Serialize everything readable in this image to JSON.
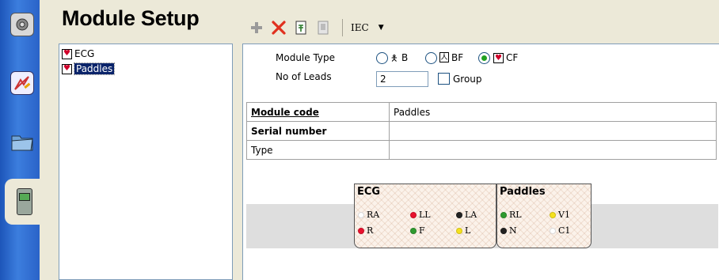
{
  "header": {
    "title": "Module Setup"
  },
  "toolbar": {
    "add_icon": "plus-icon",
    "delete_icon": "red-x-icon",
    "iec_label": "IEC"
  },
  "tree": {
    "items": [
      {
        "label": "ECG",
        "selected": false
      },
      {
        "label": "Paddles",
        "selected": true
      }
    ]
  },
  "form": {
    "module_type_label": "Module Type",
    "options": [
      {
        "label": "B",
        "checked": false
      },
      {
        "label": "BF",
        "checked": false
      },
      {
        "label": "CF",
        "checked": true
      }
    ],
    "leads_label": "No of Leads",
    "leads_value": "2",
    "group_label": "Group",
    "group_checked": false
  },
  "properties": [
    {
      "key": "Module code",
      "value": "Paddles"
    },
    {
      "key": "Serial number",
      "value": ""
    },
    {
      "key": "Type",
      "value": ""
    }
  ],
  "electrodes": {
    "ecg": {
      "title": "ECG",
      "items": [
        {
          "label": "RA",
          "color": "#ffffff"
        },
        {
          "label": "LL",
          "color": "#e8112d"
        },
        {
          "label": "LA",
          "color": "#222222"
        },
        {
          "label": "R",
          "color": "#e8112d"
        },
        {
          "label": "F",
          "color": "#2f9a2f"
        },
        {
          "label": "L",
          "color": "#f5e11e"
        }
      ]
    },
    "paddles": {
      "title": "Paddles",
      "items": [
        {
          "label": "RL",
          "color": "#2f9a2f"
        },
        {
          "label": "V1",
          "color": "#f5e11e"
        },
        {
          "label": "N",
          "color": "#222222"
        },
        {
          "label": "C1",
          "color": "#ffffff"
        }
      ]
    }
  }
}
